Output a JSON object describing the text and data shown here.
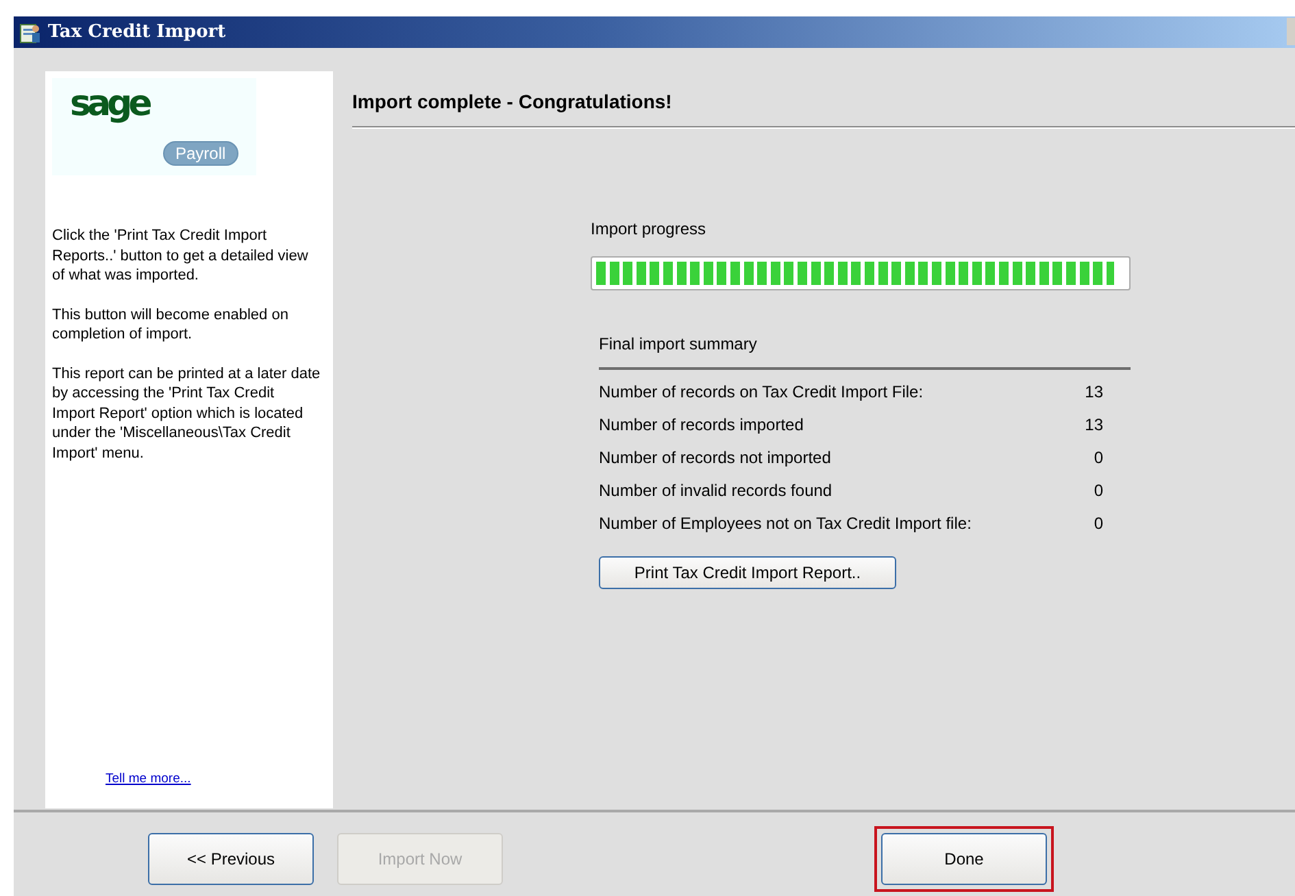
{
  "window": {
    "title": "Tax Credit Import"
  },
  "sidebar": {
    "logo": {
      "brand": "sage",
      "product": "Payroll"
    },
    "paragraphs": [
      "Click the 'Print Tax Credit Import Reports..' button to get a detailed view of what was imported.",
      "This button will become enabled on completion of import.",
      "This report can be printed at a later date by accessing the 'Print Tax Credit Import Report' option which is located under the 'Miscellaneous\\Tax Credit Import' menu."
    ],
    "link": "Tell me more..."
  },
  "heading": "Import complete - Congratulations!",
  "progress": {
    "label": "Import progress",
    "level": 0.98
  },
  "summary": {
    "title": "Final import summary",
    "rows": [
      {
        "label": "Number of records on Tax Credit Import File:",
        "value": "13"
      },
      {
        "label": "Number of records imported",
        "value": "13"
      },
      {
        "label": "Number of records not imported",
        "value": "0"
      },
      {
        "label": "Number of invalid records found",
        "value": "0"
      },
      {
        "label": "Number of Employees not on Tax Credit Import file:",
        "value": "0"
      }
    ],
    "button": "Print Tax Credit Import Report.."
  },
  "buttons": [
    {
      "label": "<< Previous",
      "disabled": false,
      "highlighted": false
    },
    {
      "label": "Import Now",
      "disabled": true,
      "highlighted": false
    },
    {
      "label": "Done",
      "disabled": false,
      "highlighted": true
    }
  ]
}
